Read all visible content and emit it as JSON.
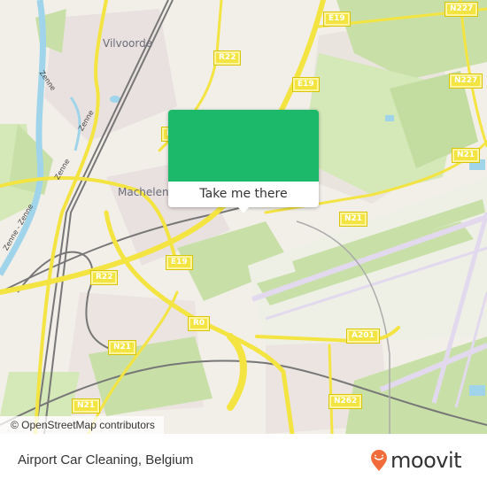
{
  "map": {
    "attribution": "© OpenStreetMap contributors",
    "places": [
      {
        "name": "Vilvoorde"
      },
      {
        "name": "Machelen"
      }
    ],
    "rivers": [
      {
        "name": "Zenne"
      },
      {
        "name": "Zenne"
      },
      {
        "name": "Zenne"
      },
      {
        "name": "Zenne - Zenne"
      }
    ],
    "road_shields": [
      "E19",
      "R22",
      "N227",
      "E19",
      "N227",
      "R22",
      "N21",
      "E19",
      "R22",
      "R0",
      "N21",
      "N21",
      "A201",
      "N262",
      "N21"
    ],
    "colors": {
      "land": "#f2efe9",
      "green": "#c8e0a8",
      "road": "#f4e442",
      "water": "#9fd4ea",
      "runway": "#e3d9ee",
      "rail": "#777777"
    }
  },
  "popup": {
    "button_label": "Take me there",
    "color": "#1db96a"
  },
  "footer": {
    "title": "Airport Car Cleaning, Belgium",
    "brand": "moovit",
    "brand_color": "#f26b3a"
  }
}
